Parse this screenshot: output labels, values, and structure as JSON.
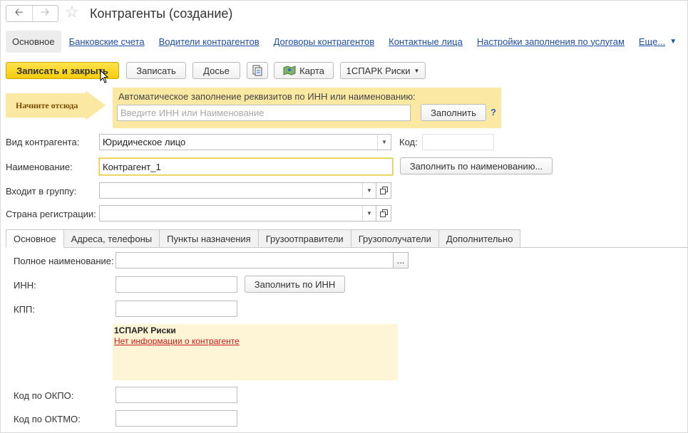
{
  "header": {
    "back_icon": "arrow-left-icon",
    "forward_icon": "arrow-right-icon",
    "favorite_icon": "star-icon",
    "title": "Контрагенты (создание)"
  },
  "nav": {
    "active": "Основное",
    "links": [
      "Банковские счета",
      "Водители контрагентов",
      "Договоры контрагентов",
      "Контактные лица",
      "Настройки заполнения по услугам"
    ],
    "more": "Еще..."
  },
  "toolbar": {
    "save_close": "Записать и закрыть",
    "save": "Записать",
    "dossier": "Досье",
    "map": "Карта",
    "spark": "1СПАРК Риски"
  },
  "banner": {
    "arrow_text": "Начните отсюда",
    "label": "Автоматическое заполнение реквизитов по ИНН или наименованию:",
    "placeholder": "Введите ИНН или Наименование",
    "fill": "Заполнить",
    "help": "?"
  },
  "form": {
    "kind_label": "Вид контрагента:",
    "kind_value": "Юридическое лицо",
    "code_label": "Код:",
    "code_value": "",
    "name_label": "Наименование:",
    "name_value": "Контрагент_1",
    "fill_by_name": "Заполнить по наименованию...",
    "group_label": "Входит в группу:",
    "group_value": "",
    "country_label": "Страна регистрации:",
    "country_value": ""
  },
  "tabs": [
    "Основное",
    "Адреса, телефоны",
    "Пункты назначения",
    "Грузоотправители",
    "Грузополучатели",
    "Дополнительно"
  ],
  "details": {
    "full_name_label": "Полное наименование:",
    "full_name_value": "",
    "ellipsis": "...",
    "inn_label": "ИНН:",
    "inn_value": "",
    "fill_by_inn": "Заполнить по ИНН",
    "kpp_label": "КПП:",
    "kpp_value": "",
    "okpo_label": "Код по ОКПО:",
    "okpo_value": "",
    "oktmo_label": "Код по ОКТМО:",
    "oktmo_value": ""
  },
  "spark_panel": {
    "title": "1СПАРК Риски",
    "link": "Нет информации о контрагенте"
  },
  "colors": {
    "primary_button": "#f5cd0c",
    "banner_bg": "#fbe9a3",
    "link": "#1f4ea3",
    "warning_link": "#d01818"
  }
}
